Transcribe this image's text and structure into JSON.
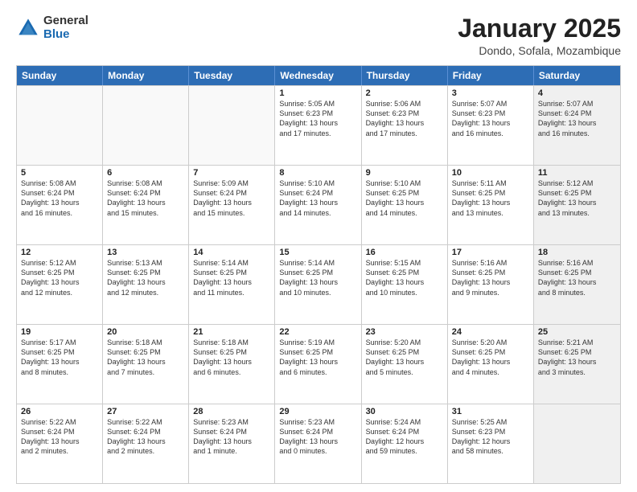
{
  "logo": {
    "general": "General",
    "blue": "Blue"
  },
  "header": {
    "month": "January 2025",
    "location": "Dondo, Sofala, Mozambique"
  },
  "weekdays": [
    "Sunday",
    "Monday",
    "Tuesday",
    "Wednesday",
    "Thursday",
    "Friday",
    "Saturday"
  ],
  "rows": [
    [
      {
        "day": "",
        "info": "",
        "empty": true
      },
      {
        "day": "",
        "info": "",
        "empty": true
      },
      {
        "day": "",
        "info": "",
        "empty": true
      },
      {
        "day": "1",
        "info": "Sunrise: 5:05 AM\nSunset: 6:23 PM\nDaylight: 13 hours\nand 17 minutes."
      },
      {
        "day": "2",
        "info": "Sunrise: 5:06 AM\nSunset: 6:23 PM\nDaylight: 13 hours\nand 17 minutes."
      },
      {
        "day": "3",
        "info": "Sunrise: 5:07 AM\nSunset: 6:23 PM\nDaylight: 13 hours\nand 16 minutes."
      },
      {
        "day": "4",
        "info": "Sunrise: 5:07 AM\nSunset: 6:24 PM\nDaylight: 13 hours\nand 16 minutes.",
        "shaded": true
      }
    ],
    [
      {
        "day": "5",
        "info": "Sunrise: 5:08 AM\nSunset: 6:24 PM\nDaylight: 13 hours\nand 16 minutes."
      },
      {
        "day": "6",
        "info": "Sunrise: 5:08 AM\nSunset: 6:24 PM\nDaylight: 13 hours\nand 15 minutes."
      },
      {
        "day": "7",
        "info": "Sunrise: 5:09 AM\nSunset: 6:24 PM\nDaylight: 13 hours\nand 15 minutes."
      },
      {
        "day": "8",
        "info": "Sunrise: 5:10 AM\nSunset: 6:24 PM\nDaylight: 13 hours\nand 14 minutes."
      },
      {
        "day": "9",
        "info": "Sunrise: 5:10 AM\nSunset: 6:25 PM\nDaylight: 13 hours\nand 14 minutes."
      },
      {
        "day": "10",
        "info": "Sunrise: 5:11 AM\nSunset: 6:25 PM\nDaylight: 13 hours\nand 13 minutes."
      },
      {
        "day": "11",
        "info": "Sunrise: 5:12 AM\nSunset: 6:25 PM\nDaylight: 13 hours\nand 13 minutes.",
        "shaded": true
      }
    ],
    [
      {
        "day": "12",
        "info": "Sunrise: 5:12 AM\nSunset: 6:25 PM\nDaylight: 13 hours\nand 12 minutes."
      },
      {
        "day": "13",
        "info": "Sunrise: 5:13 AM\nSunset: 6:25 PM\nDaylight: 13 hours\nand 12 minutes."
      },
      {
        "day": "14",
        "info": "Sunrise: 5:14 AM\nSunset: 6:25 PM\nDaylight: 13 hours\nand 11 minutes."
      },
      {
        "day": "15",
        "info": "Sunrise: 5:14 AM\nSunset: 6:25 PM\nDaylight: 13 hours\nand 10 minutes."
      },
      {
        "day": "16",
        "info": "Sunrise: 5:15 AM\nSunset: 6:25 PM\nDaylight: 13 hours\nand 10 minutes."
      },
      {
        "day": "17",
        "info": "Sunrise: 5:16 AM\nSunset: 6:25 PM\nDaylight: 13 hours\nand 9 minutes."
      },
      {
        "day": "18",
        "info": "Sunrise: 5:16 AM\nSunset: 6:25 PM\nDaylight: 13 hours\nand 8 minutes.",
        "shaded": true
      }
    ],
    [
      {
        "day": "19",
        "info": "Sunrise: 5:17 AM\nSunset: 6:25 PM\nDaylight: 13 hours\nand 8 minutes."
      },
      {
        "day": "20",
        "info": "Sunrise: 5:18 AM\nSunset: 6:25 PM\nDaylight: 13 hours\nand 7 minutes."
      },
      {
        "day": "21",
        "info": "Sunrise: 5:18 AM\nSunset: 6:25 PM\nDaylight: 13 hours\nand 6 minutes."
      },
      {
        "day": "22",
        "info": "Sunrise: 5:19 AM\nSunset: 6:25 PM\nDaylight: 13 hours\nand 6 minutes."
      },
      {
        "day": "23",
        "info": "Sunrise: 5:20 AM\nSunset: 6:25 PM\nDaylight: 13 hours\nand 5 minutes."
      },
      {
        "day": "24",
        "info": "Sunrise: 5:20 AM\nSunset: 6:25 PM\nDaylight: 13 hours\nand 4 minutes."
      },
      {
        "day": "25",
        "info": "Sunrise: 5:21 AM\nSunset: 6:25 PM\nDaylight: 13 hours\nand 3 minutes.",
        "shaded": true
      }
    ],
    [
      {
        "day": "26",
        "info": "Sunrise: 5:22 AM\nSunset: 6:24 PM\nDaylight: 13 hours\nand 2 minutes."
      },
      {
        "day": "27",
        "info": "Sunrise: 5:22 AM\nSunset: 6:24 PM\nDaylight: 13 hours\nand 2 minutes."
      },
      {
        "day": "28",
        "info": "Sunrise: 5:23 AM\nSunset: 6:24 PM\nDaylight: 13 hours\nand 1 minute."
      },
      {
        "day": "29",
        "info": "Sunrise: 5:23 AM\nSunset: 6:24 PM\nDaylight: 13 hours\nand 0 minutes."
      },
      {
        "day": "30",
        "info": "Sunrise: 5:24 AM\nSunset: 6:24 PM\nDaylight: 12 hours\nand 59 minutes."
      },
      {
        "day": "31",
        "info": "Sunrise: 5:25 AM\nSunset: 6:23 PM\nDaylight: 12 hours\nand 58 minutes."
      },
      {
        "day": "",
        "info": "",
        "empty": true,
        "shaded": true
      }
    ]
  ]
}
